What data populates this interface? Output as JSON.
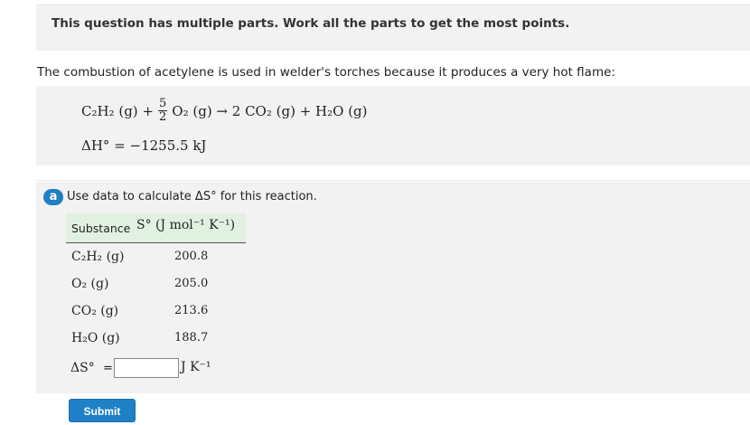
{
  "banner": {
    "text": "This question has multiple parts. Work all the parts to get the most points."
  },
  "intro": {
    "text": "The combustion of acetylene is used in welder's torches because it produces a very hot flame:"
  },
  "equation": {
    "reactant1": "C₂H₂ (g) +",
    "coef_num": "5",
    "coef_den": "2",
    "reactant2_products": "O₂ (g) → 2 CO₂ (g) + H₂O (g)",
    "enthalpy": "ΔH° = −1255.5 kJ"
  },
  "part_a": {
    "badge": "a",
    "prompt": "Use data to calculate ΔS° for this reaction.",
    "table": {
      "headers": [
        "Substance",
        "S° (J mol⁻¹ K⁻¹)"
      ],
      "rows": [
        {
          "substance": "C₂H₂ (g)",
          "value": "200.8"
        },
        {
          "substance": "O₂ (g)",
          "value": "205.0"
        },
        {
          "substance": "CO₂ (g)",
          "value": "213.6"
        },
        {
          "substance": "H₂O (g)",
          "value": "188.7"
        }
      ]
    },
    "answer": {
      "label": "ΔS°",
      "equals": "=",
      "value": "",
      "unit": "J K⁻¹"
    }
  },
  "submit": {
    "label": "Submit"
  }
}
